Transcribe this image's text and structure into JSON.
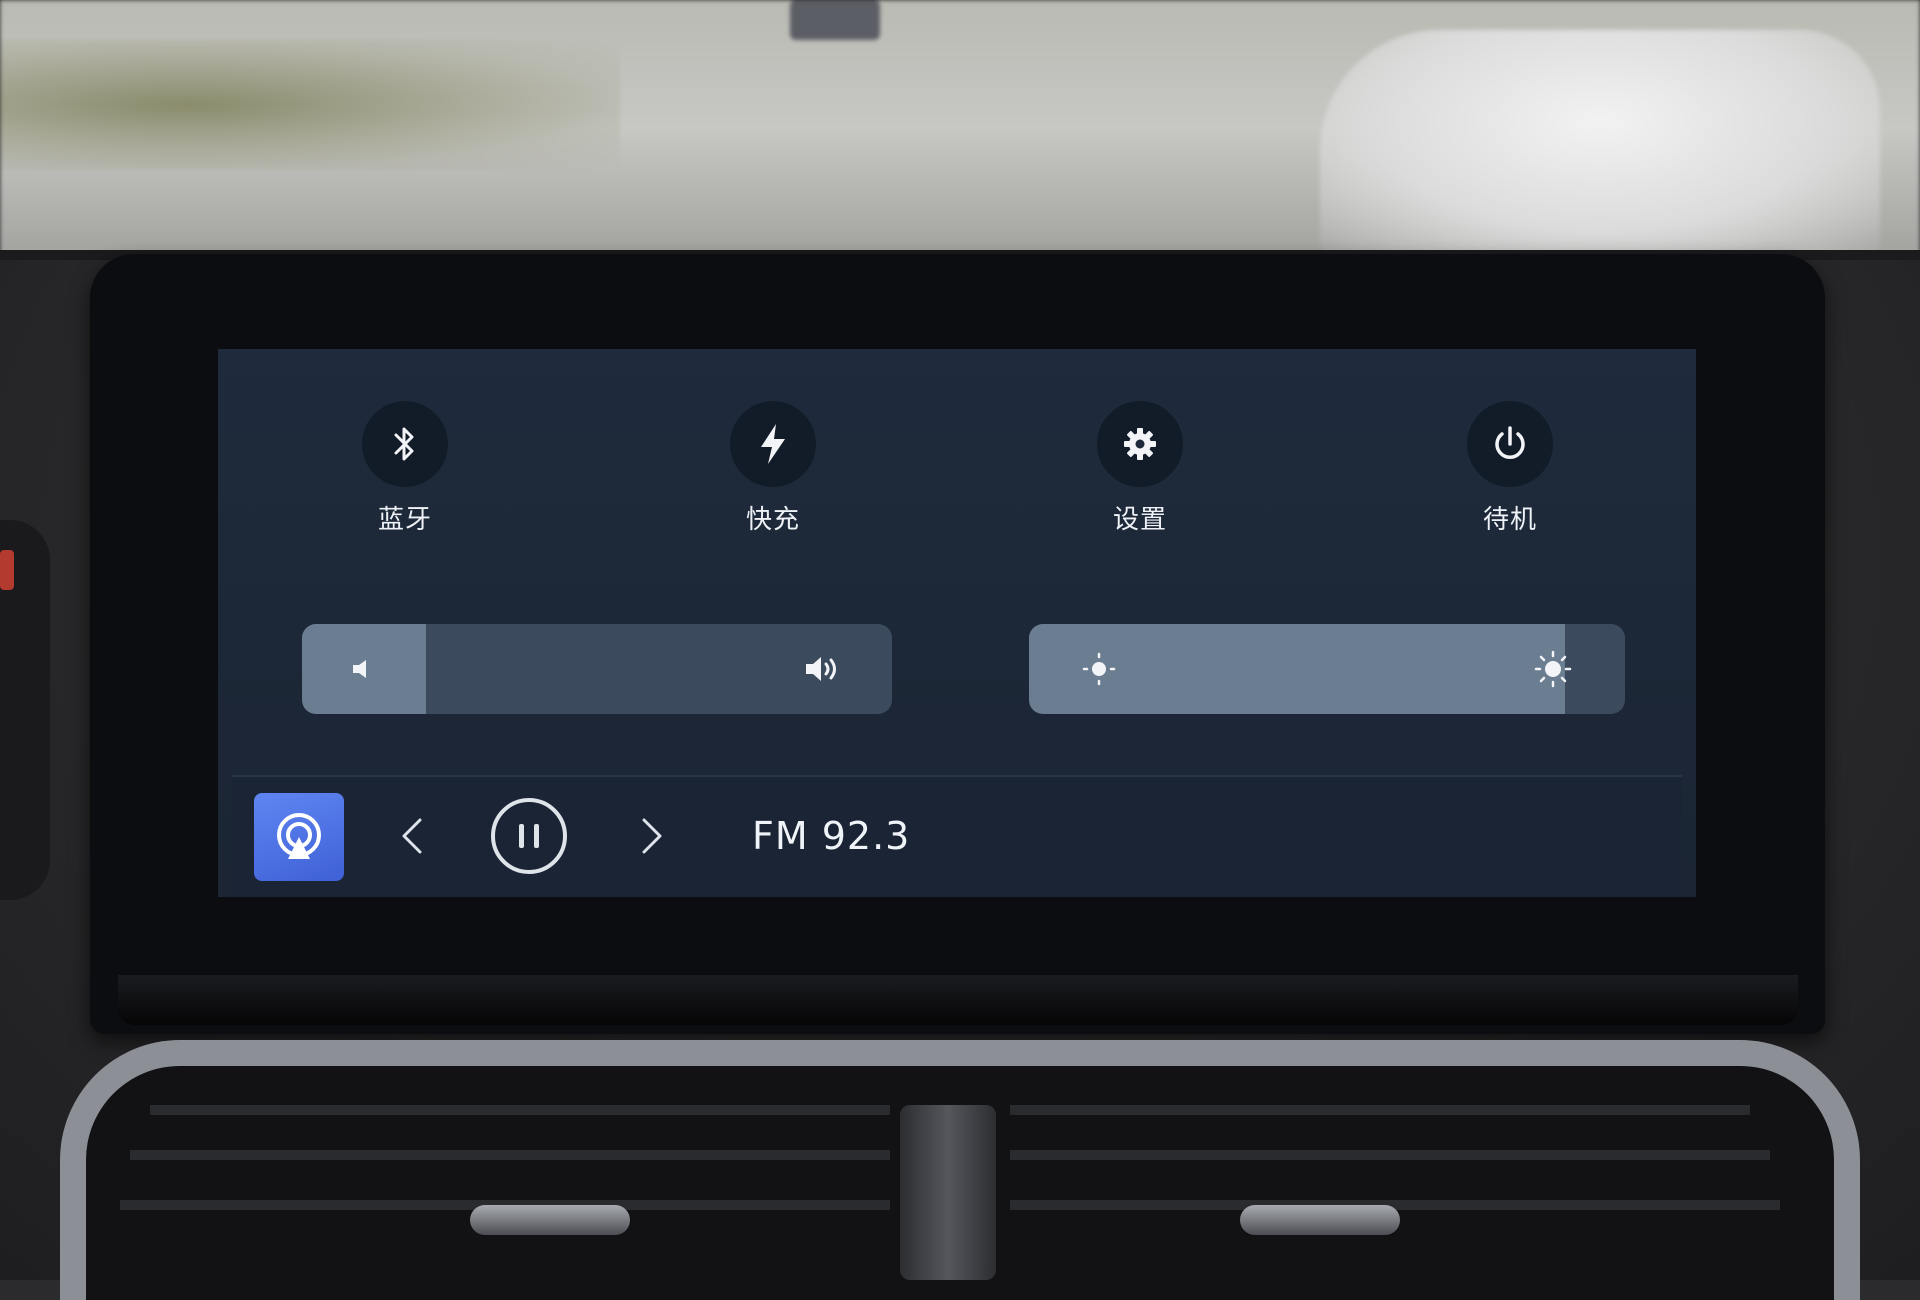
{
  "quick_settings": [
    {
      "id": "bluetooth",
      "label": "蓝牙",
      "icon": "bluetooth-icon"
    },
    {
      "id": "fast-charge",
      "label": "快充",
      "icon": "lightning-icon"
    },
    {
      "id": "settings",
      "label": "设置",
      "icon": "gear-icon"
    },
    {
      "id": "standby",
      "label": "待机",
      "icon": "power-icon"
    }
  ],
  "volume_slider": {
    "min_icon": "speaker-low-icon",
    "max_icon": "speaker-high-icon",
    "level_fraction": 0.21
  },
  "brightness_slider": {
    "min_icon": "brightness-low-icon",
    "max_icon": "brightness-high-icon",
    "level_fraction": 0.9
  },
  "media_bar": {
    "app_icon": "radio-icon",
    "prev_icon": "chevron-left-icon",
    "play_pause_icon": "pause-icon",
    "next_icon": "chevron-right-icon",
    "station": "FM 92.3"
  },
  "colors": {
    "display_bg": "#1e2a3b",
    "slider_track": "#3b4a5d",
    "slider_fill": "#6b7d90",
    "app_tile_accent": "#4f73e6",
    "text": "#eef2f6"
  }
}
